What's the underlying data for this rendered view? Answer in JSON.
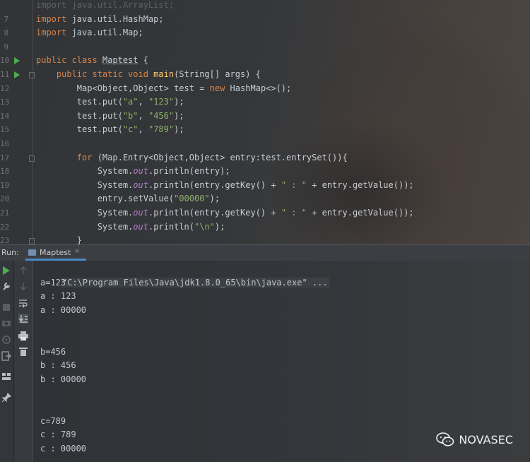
{
  "editor": {
    "lines": [
      {
        "n": "",
        "segs": [
          {
            "t": "import java.util.ArrayList;",
            "c": "dim"
          }
        ]
      },
      {
        "n": "7",
        "segs": [
          {
            "t": "import ",
            "c": "k"
          },
          {
            "t": "java.util.HashMap;",
            "c": ""
          }
        ]
      },
      {
        "n": "8",
        "segs": [
          {
            "t": "import ",
            "c": "k"
          },
          {
            "t": "java.util.Map;",
            "c": ""
          }
        ]
      },
      {
        "n": "9",
        "segs": []
      },
      {
        "n": "10",
        "run": true,
        "segs": [
          {
            "t": "public class ",
            "c": "k"
          },
          {
            "t": "Maptest",
            "c": "cls"
          },
          {
            "t": " {",
            "c": ""
          }
        ]
      },
      {
        "n": "11",
        "run": true,
        "fold": true,
        "segs": [
          {
            "t": "    public static void ",
            "c": "k"
          },
          {
            "t": "main",
            "c": "f"
          },
          {
            "t": "(String[] args) {",
            "c": ""
          }
        ]
      },
      {
        "n": "12",
        "segs": [
          {
            "t": "        Map<Object,Object> test = ",
            "c": ""
          },
          {
            "t": "new ",
            "c": "k"
          },
          {
            "t": "HashMap<>();",
            "c": ""
          }
        ]
      },
      {
        "n": "13",
        "segs": [
          {
            "t": "        test.put(",
            "c": ""
          },
          {
            "t": "\"a\"",
            "c": "s"
          },
          {
            "t": ", ",
            "c": ""
          },
          {
            "t": "\"123\"",
            "c": "s"
          },
          {
            "t": ");",
            "c": ""
          }
        ]
      },
      {
        "n": "14",
        "segs": [
          {
            "t": "        test.put(",
            "c": ""
          },
          {
            "t": "\"b\"",
            "c": "s"
          },
          {
            "t": ", ",
            "c": ""
          },
          {
            "t": "\"456\"",
            "c": "s"
          },
          {
            "t": ");",
            "c": ""
          }
        ]
      },
      {
        "n": "15",
        "segs": [
          {
            "t": "        test.put(",
            "c": ""
          },
          {
            "t": "\"c\"",
            "c": "s"
          },
          {
            "t": ", ",
            "c": ""
          },
          {
            "t": "\"789\"",
            "c": "s"
          },
          {
            "t": ");",
            "c": ""
          }
        ]
      },
      {
        "n": "16",
        "segs": []
      },
      {
        "n": "17",
        "fold": true,
        "segs": [
          {
            "t": "        for ",
            "c": "k"
          },
          {
            "t": "(Map.Entry<Object,Object> entry:test.entrySet()){",
            "c": ""
          }
        ]
      },
      {
        "n": "18",
        "segs": [
          {
            "t": "            System.",
            "c": ""
          },
          {
            "t": "out",
            "c": "st"
          },
          {
            "t": ".println(entry);",
            "c": ""
          }
        ]
      },
      {
        "n": "19",
        "segs": [
          {
            "t": "            System.",
            "c": ""
          },
          {
            "t": "out",
            "c": "st"
          },
          {
            "t": ".println(entry.getKey() + ",
            "c": ""
          },
          {
            "t": "\" : \"",
            "c": "s"
          },
          {
            "t": " + entry.getValue());",
            "c": ""
          }
        ]
      },
      {
        "n": "20",
        "segs": [
          {
            "t": "            entry.setValue(",
            "c": ""
          },
          {
            "t": "\"00000\"",
            "c": "s"
          },
          {
            "t": ");",
            "c": ""
          }
        ]
      },
      {
        "n": "21",
        "segs": [
          {
            "t": "            System.",
            "c": ""
          },
          {
            "t": "out",
            "c": "st"
          },
          {
            "t": ".println(entry.getKey() + ",
            "c": ""
          },
          {
            "t": "\" : \"",
            "c": "s"
          },
          {
            "t": " + entry.getValue());",
            "c": ""
          }
        ]
      },
      {
        "n": "22",
        "segs": [
          {
            "t": "            System.",
            "c": ""
          },
          {
            "t": "out",
            "c": "st"
          },
          {
            "t": ".println(",
            "c": ""
          },
          {
            "t": "\"\\n\"",
            "c": "s"
          },
          {
            "t": ");",
            "c": ""
          }
        ]
      },
      {
        "n": "23",
        "fold": true,
        "segs": [
          {
            "t": "        }",
            "c": ""
          }
        ]
      }
    ]
  },
  "run": {
    "label": "Run:",
    "tab_label": "Maptest",
    "tab_close": "×"
  },
  "console": {
    "command": "\"C:\\Program Files\\Java\\jdk1.8.0_65\\bin\\java.exe\" ...",
    "lines": [
      "a=123",
      "a : 123",
      "a : 00000",
      "",
      "",
      "b=456",
      "b : 456",
      "b : 00000",
      "",
      "",
      "c=789",
      "c : 789",
      "c : 00000"
    ]
  },
  "watermark": {
    "text": "NOVASEC"
  },
  "colors": {
    "keyword": "#d7844a",
    "string": "#8fb06d",
    "method": "#ffc66d",
    "static_field": "#b07cc8",
    "run_green": "#4caf50",
    "tab_accent": "#4a88c7"
  }
}
